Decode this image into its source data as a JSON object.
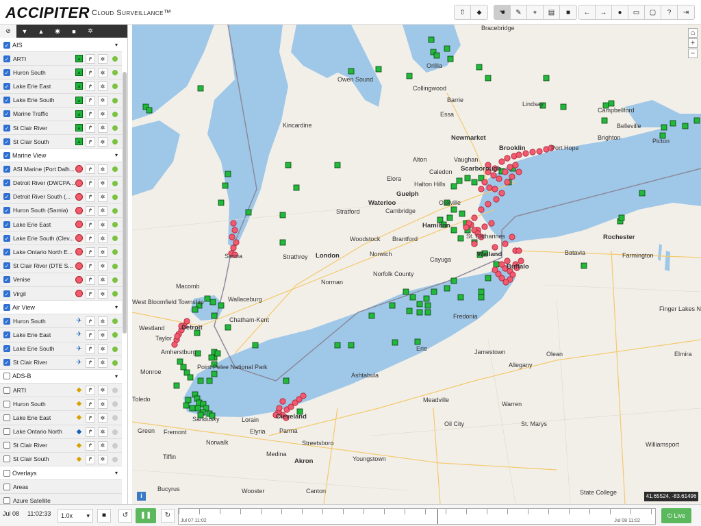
{
  "app": {
    "logo": "ACCIPITER",
    "subtitle": "Cloud Surveillance™"
  },
  "toolbar": {
    "group1": [
      "⇧",
      "⬥"
    ],
    "group2": [
      "☚",
      "✎",
      "⌖",
      "▤",
      "■"
    ],
    "group3": [
      "←",
      "→",
      "●",
      "▭",
      "▢",
      "?",
      "⇥"
    ]
  },
  "sidebar": {
    "tabs": [
      "⊘",
      "▼",
      "▲",
      "◉",
      "■",
      "✲"
    ],
    "groups": [
      {
        "label": "AIS",
        "checked": true,
        "items": [
          {
            "label": "ARTI",
            "icon": "ais",
            "status": "green"
          },
          {
            "label": "Huron South",
            "icon": "ais",
            "status": "green"
          },
          {
            "label": "Lake Erie East",
            "icon": "ais",
            "status": "green"
          },
          {
            "label": "Lake Erie South",
            "icon": "ais",
            "status": "green"
          },
          {
            "label": "Marine Traffic",
            "icon": "ais",
            "status": "green"
          },
          {
            "label": "St Clair River",
            "icon": "ais",
            "status": "green"
          },
          {
            "label": "St Clair South",
            "icon": "ais",
            "status": "green"
          }
        ]
      },
      {
        "label": "Marine View",
        "checked": true,
        "items": [
          {
            "label": "ASI Marine (Port Dalh...",
            "icon": "marine",
            "status": "green"
          },
          {
            "label": "Detroit River (DWCPA...",
            "icon": "marine",
            "status": "green"
          },
          {
            "label": "Detroit River South (...",
            "icon": "marine",
            "status": "green"
          },
          {
            "label": "Huron South (Sarnia)",
            "icon": "marine",
            "status": "green"
          },
          {
            "label": "Lake Erie East",
            "icon": "marine",
            "status": "green"
          },
          {
            "label": "Lake Erie South (Clev...",
            "icon": "marine",
            "status": "green"
          },
          {
            "label": "Lake Ontario North E...",
            "icon": "marine",
            "status": "green"
          },
          {
            "label": "St Clair River (DTE S...",
            "icon": "marine",
            "status": "green"
          },
          {
            "label": "Venise",
            "icon": "marine",
            "status": "green"
          },
          {
            "label": "Virgil",
            "icon": "marine",
            "status": "green"
          }
        ]
      },
      {
        "label": "Air View",
        "checked": true,
        "items": [
          {
            "label": "Huron South",
            "icon": "air",
            "status": "green"
          },
          {
            "label": "Lake Erie East",
            "icon": "air",
            "status": "green"
          },
          {
            "label": "Lake Erie South",
            "icon": "air",
            "status": "green"
          },
          {
            "label": "St Clair River",
            "icon": "air",
            "status": "green"
          }
        ]
      },
      {
        "label": "ADS-B",
        "checked": false,
        "items": [
          {
            "label": "ARTI",
            "icon": "adsb",
            "status": "gray"
          },
          {
            "label": "Huron South",
            "icon": "adsb",
            "status": "gray"
          },
          {
            "label": "Lake Erie East",
            "icon": "adsb",
            "status": "gray"
          },
          {
            "label": "Lake Ontario North",
            "icon": "adsb-blue",
            "status": "gray"
          },
          {
            "label": "St Clair River",
            "icon": "adsb",
            "status": "gray"
          },
          {
            "label": "St Clair South",
            "icon": "adsb",
            "status": "gray"
          }
        ]
      },
      {
        "label": "Overlays",
        "checked": false,
        "items": [
          {
            "label": "Areas",
            "icon": "",
            "status": ""
          },
          {
            "label": "Azure Satellite",
            "icon": "",
            "status": ""
          }
        ]
      }
    ]
  },
  "map": {
    "labels": [
      "Bracebridge",
      "Owen Sound",
      "Collingwood",
      "Barrie",
      "Orillia",
      "Lindsay",
      "Campbellford",
      "Belleville",
      "Picton",
      "Kincardine",
      "Essa",
      "Newmarket",
      "Brooklin",
      "Port Hope",
      "Brighton",
      "Alton",
      "Vaughan",
      "Scarborough",
      "Caledon",
      "Guelph",
      "Halton Hills",
      "Elora",
      "Waterloo",
      "Cambridge",
      "Oakville",
      "Hamilton",
      "Brantford",
      "Stratford",
      "Woodstock",
      "St. Catharines",
      "Rochester",
      "Welland",
      "Buffalo",
      "Batavia",
      "Farmington",
      "Strathroy",
      "London",
      "Norwich",
      "Cayuga",
      "Norfolk County",
      "Sarnia",
      "Macomb",
      "West Bloomfield Township",
      "Wallaceburg",
      "Norman",
      "Chatham-Kent",
      "Detroit",
      "Westland",
      "Taylor",
      "Amherstburg",
      "Monroe",
      "Fredonia",
      "Erie",
      "Jamestown",
      "Olean",
      "Elmira",
      "Ashtabula",
      "Toledo",
      "Sandusky",
      "Lorain",
      "Cleveland",
      "Elyria",
      "Parma",
      "Green",
      "Fremont",
      "Norwalk",
      "Medina",
      "Streetsboro",
      "Youngstown",
      "Meadville",
      "Oil City",
      "Warren",
      "St. Marys",
      "Williamsport",
      "State College",
      "Akron",
      "Canton",
      "Tiffin",
      "Bucyrus",
      "Wooster",
      "Finger Lakes National Forest",
      "Point Pelee National Park",
      "Allegany"
    ],
    "coords": "41.65524, -83.61496",
    "zoom": [
      "⌂",
      "+",
      "−"
    ]
  },
  "bottom": {
    "date": "Jul 08",
    "time": "11:02:33",
    "speed": "1.0x",
    "timeline_start": "Jul 07 11:02",
    "timeline_end": "Jul 08 11:02",
    "live": "Live"
  }
}
